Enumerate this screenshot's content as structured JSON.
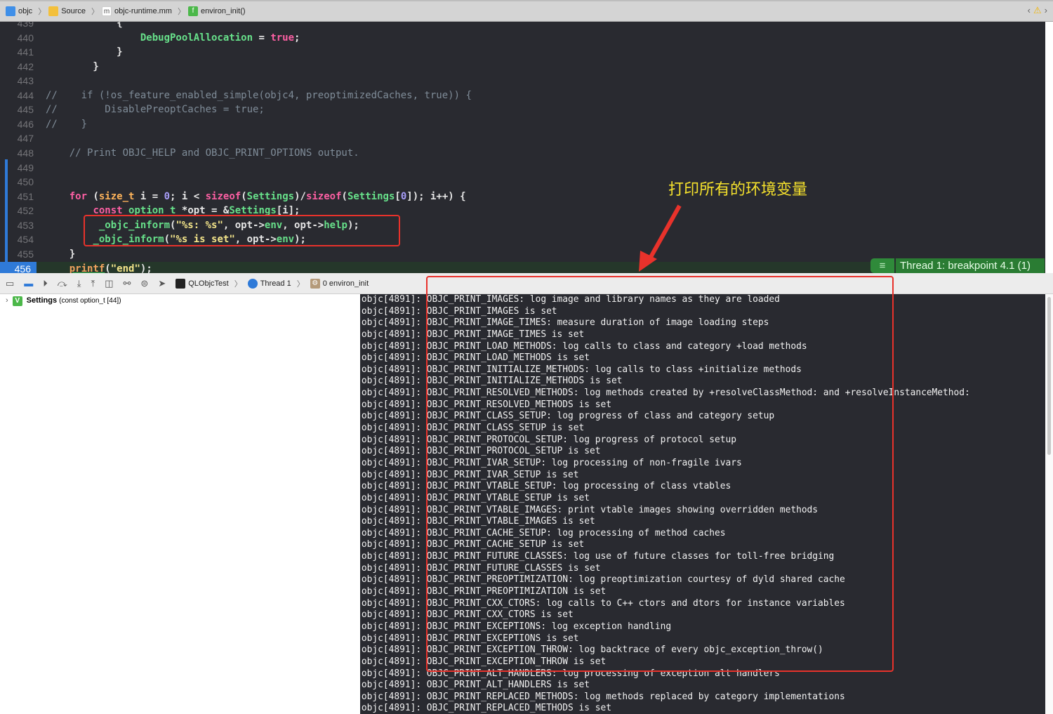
{
  "breadcrumb": [
    {
      "label": "objc",
      "icon": "project-icon",
      "color": "#3f8fe8"
    },
    {
      "label": "Source",
      "icon": "folder-icon",
      "color": "#f3c03c"
    },
    {
      "label": "objc-runtime.mm",
      "icon": "objc-file-icon",
      "color": "#ffffff"
    },
    {
      "label": "environ_init()",
      "icon": "function-icon",
      "color": "#4cb84a"
    }
  ],
  "nav": {
    "prev": "‹",
    "warning": "⚠",
    "next": "›"
  },
  "editor": {
    "lines": [
      {
        "n": "439",
        "tokens": [
          [
            "o",
            "            {"
          ]
        ]
      },
      {
        "n": "440",
        "tokens": [
          [
            "o",
            "                "
          ],
          [
            "t",
            "DebugPoolAllocation"
          ],
          [
            "o",
            " = "
          ],
          [
            "k",
            "true"
          ],
          [
            "o",
            ";"
          ]
        ]
      },
      {
        "n": "441",
        "tokens": [
          [
            "o",
            "            }"
          ]
        ]
      },
      {
        "n": "442",
        "tokens": [
          [
            "o",
            "        }"
          ]
        ]
      },
      {
        "n": "443",
        "tokens": []
      },
      {
        "n": "444",
        "tokens": [
          [
            "c",
            "//    if (!os_feature_enabled_simple(objc4, preoptimizedCaches, true)) {"
          ]
        ]
      },
      {
        "n": "445",
        "tokens": [
          [
            "c",
            "//        DisablePreoptCaches = true;"
          ]
        ]
      },
      {
        "n": "446",
        "tokens": [
          [
            "c",
            "//    }"
          ]
        ]
      },
      {
        "n": "447",
        "tokens": []
      },
      {
        "n": "448",
        "tokens": [
          [
            "c",
            "    // Print OBJC_HELP and OBJC_PRINT_OPTIONS output."
          ]
        ]
      },
      {
        "n": "449",
        "tokens": []
      },
      {
        "n": "450",
        "tokens": []
      },
      {
        "n": "451",
        "tokens": [
          [
            "o",
            "    "
          ],
          [
            "k",
            "for"
          ],
          [
            "o",
            " ("
          ],
          [
            "tp",
            "size_t"
          ],
          [
            "o",
            " i = "
          ],
          [
            "n",
            "0"
          ],
          [
            "o",
            "; i < "
          ],
          [
            "k",
            "sizeof"
          ],
          [
            "o",
            "("
          ],
          [
            "t",
            "Settings"
          ],
          [
            "o",
            ")/"
          ],
          [
            "k",
            "sizeof"
          ],
          [
            "o",
            "("
          ],
          [
            "t",
            "Settings"
          ],
          [
            "o",
            "["
          ],
          [
            "n",
            "0"
          ],
          [
            "o",
            "]); i++) {"
          ]
        ]
      },
      {
        "n": "452",
        "tokens": [
          [
            "o",
            "        "
          ],
          [
            "k",
            "const"
          ],
          [
            "o",
            " "
          ],
          [
            "t",
            "option_t"
          ],
          [
            "o",
            " *opt = &"
          ],
          [
            "t",
            "Settings"
          ],
          [
            "o",
            "[i];"
          ]
        ]
      },
      {
        "n": "453",
        "tokens": [
          [
            "o",
            "         "
          ],
          [
            "t",
            "_objc_inform"
          ],
          [
            "o",
            "("
          ],
          [
            "s",
            "\"%s: %s\""
          ],
          [
            "o",
            ", opt->"
          ],
          [
            "t",
            "env"
          ],
          [
            "o",
            ", opt->"
          ],
          [
            "t",
            "help"
          ],
          [
            "o",
            ");"
          ]
        ]
      },
      {
        "n": "454",
        "tokens": [
          [
            "o",
            "        "
          ],
          [
            "t",
            "_objc_inform"
          ],
          [
            "o",
            "("
          ],
          [
            "s",
            "\"%s is set\""
          ],
          [
            "o",
            ", opt->"
          ],
          [
            "t",
            "env"
          ],
          [
            "o",
            ");"
          ]
        ]
      },
      {
        "n": "455",
        "tokens": [
          [
            "o",
            "    }"
          ]
        ]
      },
      {
        "n": "456",
        "tokens": [
          [
            "o",
            "    "
          ],
          [
            "f",
            "printf"
          ],
          [
            "o",
            "("
          ],
          [
            "s",
            "\"end\""
          ],
          [
            "o",
            ");"
          ]
        ],
        "current": true
      }
    ]
  },
  "breakpoint": {
    "label": "Thread 1: breakpoint 4.1 (1)"
  },
  "debug_bar": {
    "process": "QLObjcTest",
    "thread": "Thread 1",
    "frame": "0 environ_init"
  },
  "variables": [
    {
      "name": "Settings",
      "type": "(const option_t [44])",
      "badge": "V"
    }
  ],
  "annotation": "打印所有的环境变量",
  "console": {
    "prefix": "objc[4891]: ",
    "lines": [
      "OBJC_PRINT_IMAGES: log image and library names as they are loaded",
      "OBJC_PRINT_IMAGES is set",
      "OBJC_PRINT_IMAGE_TIMES: measure duration of image loading steps",
      "OBJC_PRINT_IMAGE_TIMES is set",
      "OBJC_PRINT_LOAD_METHODS: log calls to class and category +load methods",
      "OBJC_PRINT_LOAD_METHODS is set",
      "OBJC_PRINT_INITIALIZE_METHODS: log calls to class +initialize methods",
      "OBJC_PRINT_INITIALIZE_METHODS is set",
      "OBJC_PRINT_RESOLVED_METHODS: log methods created by +resolveClassMethod: and +resolveInstanceMethod:",
      "OBJC_PRINT_RESOLVED_METHODS is set",
      "OBJC_PRINT_CLASS_SETUP: log progress of class and category setup",
      "OBJC_PRINT_CLASS_SETUP is set",
      "OBJC_PRINT_PROTOCOL_SETUP: log progress of protocol setup",
      "OBJC_PRINT_PROTOCOL_SETUP is set",
      "OBJC_PRINT_IVAR_SETUP: log processing of non-fragile ivars",
      "OBJC_PRINT_IVAR_SETUP is set",
      "OBJC_PRINT_VTABLE_SETUP: log processing of class vtables",
      "OBJC_PRINT_VTABLE_SETUP is set",
      "OBJC_PRINT_VTABLE_IMAGES: print vtable images showing overridden methods",
      "OBJC_PRINT_VTABLE_IMAGES is set",
      "OBJC_PRINT_CACHE_SETUP: log processing of method caches",
      "OBJC_PRINT_CACHE_SETUP is set",
      "OBJC_PRINT_FUTURE_CLASSES: log use of future classes for toll-free bridging",
      "OBJC_PRINT_FUTURE_CLASSES is set",
      "OBJC_PRINT_PREOPTIMIZATION: log preoptimization courtesy of dyld shared cache",
      "OBJC_PRINT_PREOPTIMIZATION is set",
      "OBJC_PRINT_CXX_CTORS: log calls to C++ ctors and dtors for instance variables",
      "OBJC_PRINT_CXX_CTORS is set",
      "OBJC_PRINT_EXCEPTIONS: log exception handling",
      "OBJC_PRINT_EXCEPTIONS is set",
      "OBJC_PRINT_EXCEPTION_THROW: log backtrace of every objc_exception_throw()",
      "OBJC_PRINT_EXCEPTION_THROW is set",
      "OBJC_PRINT_ALT_HANDLERS: log processing of exception alt handlers",
      "OBJC_PRINT_ALT_HANDLERS is set",
      "OBJC_PRINT_REPLACED_METHODS: log methods replaced by category implementations",
      "OBJC_PRINT_REPLACED_METHODS is set"
    ]
  },
  "colors": {
    "highlight_box": "#e8322b",
    "annotation": "#f5e12c",
    "breakpoint": "#2a7c33",
    "current_line": "#2f7ad8"
  }
}
